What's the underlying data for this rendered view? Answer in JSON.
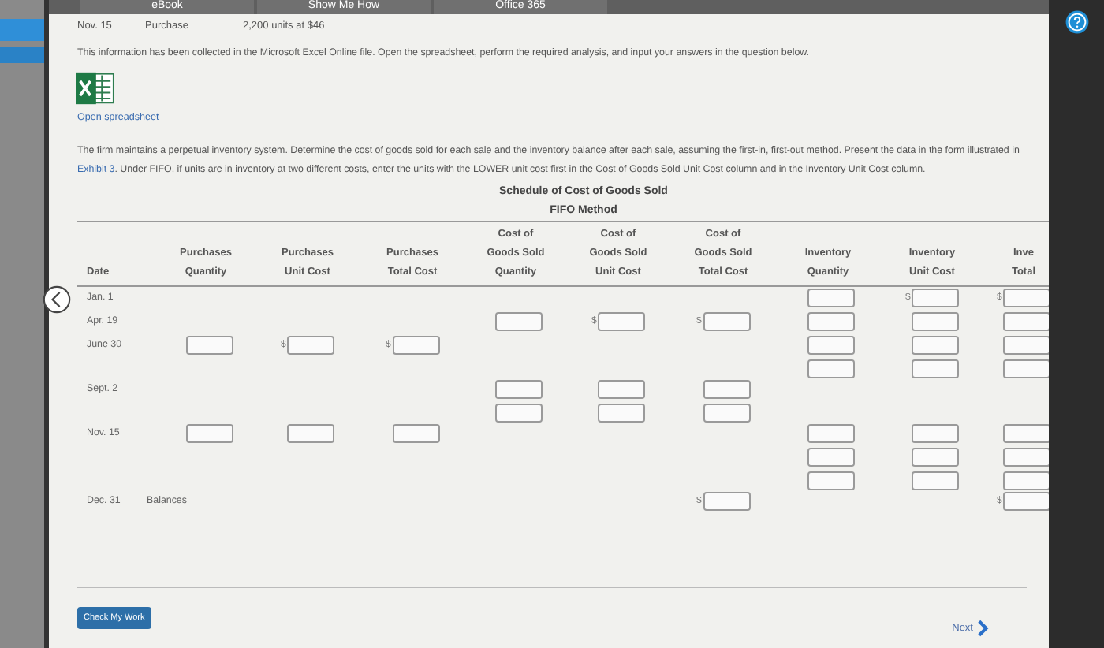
{
  "tabs": [
    {
      "label": "eBook"
    },
    {
      "label": "Show Me How"
    },
    {
      "label": "Office 365"
    }
  ],
  "info_row": {
    "date": "Nov. 15",
    "type": "Purchase",
    "detail": "2,200 units at $46"
  },
  "intro": "This information has been collected in the Microsoft Excel Online file. Open the spreadsheet, perform the required analysis, and input your answers in the question below.",
  "spreadsheet_link": "Open spreadsheet",
  "instructions": {
    "before": "The firm maintains a perpetual inventory system. Determine the cost of goods sold for each sale and the inventory balance after each sale, assuming the first-in, first-out method. Present the data in the form illustrated in ",
    "link": "Exhibit 3",
    "after": ". Under FIFO, if units are in inventory at two different costs, enter the units with the LOWER unit cost first in the Cost of Goods Sold Unit Cost column and in the Inventory Unit Cost column."
  },
  "schedule": {
    "title": "Schedule of Cost of Goods Sold",
    "subtitle": "FIFO Method",
    "columns": [
      "Date",
      "Purchases Quantity",
      "Purchases Unit Cost",
      "Purchases Total Cost",
      "Cost of Goods Sold Quantity",
      "Cost of Goods Sold Unit Cost",
      "Cost of Goods Sold Total Cost",
      "Inventory Quantity",
      "Inventory Unit Cost",
      "Inve Total"
    ],
    "rows": [
      {
        "cells": [
          {
            "text": "Jan. 1"
          },
          {},
          {},
          {},
          {},
          {},
          {},
          {
            "fields": [
              {
                "kind": "plain"
              }
            ]
          },
          {
            "fields": [
              {
                "kind": "money",
                "prefix": "$"
              }
            ]
          },
          {
            "fields": [
              {
                "kind": "money",
                "prefix": "$"
              }
            ]
          }
        ]
      },
      {
        "cells": [
          {
            "text": "Apr. 19"
          },
          {},
          {},
          {},
          {
            "fields": [
              {
                "kind": "plain"
              }
            ]
          },
          {
            "fields": [
              {
                "kind": "money",
                "prefix": "$"
              }
            ]
          },
          {
            "fields": [
              {
                "kind": "money",
                "prefix": "$"
              }
            ]
          },
          {
            "fields": [
              {
                "kind": "plain"
              }
            ]
          },
          {
            "fields": [
              {
                "kind": "plain"
              }
            ]
          },
          {
            "fields": [
              {
                "kind": "plain"
              }
            ]
          }
        ]
      },
      {
        "cells": [
          {
            "text": "June 30"
          },
          {
            "fields": [
              {
                "kind": "plain"
              }
            ]
          },
          {
            "fields": [
              {
                "kind": "money",
                "prefix": "$"
              }
            ]
          },
          {
            "fields": [
              {
                "kind": "money",
                "prefix": "$"
              }
            ]
          },
          {},
          {},
          {},
          {
            "fields": [
              {
                "kind": "plain"
              },
              {
                "kind": "plain"
              }
            ]
          },
          {
            "fields": [
              {
                "kind": "plain"
              },
              {
                "kind": "plain"
              }
            ]
          },
          {
            "fields": [
              {
                "kind": "plain"
              },
              {
                "kind": "plain"
              }
            ]
          }
        ]
      },
      {
        "cells": [
          {
            "text": "Sept. 2"
          },
          {},
          {},
          {},
          {
            "fields": [
              {
                "kind": "plain"
              },
              {
                "kind": "plain"
              }
            ]
          },
          {
            "fields": [
              {
                "kind": "plain"
              },
              {
                "kind": "plain"
              }
            ]
          },
          {
            "fields": [
              {
                "kind": "plain"
              },
              {
                "kind": "plain"
              }
            ]
          },
          {},
          {},
          {}
        ]
      },
      {
        "cells": [
          {
            "text": "Nov. 15"
          },
          {
            "fields": [
              {
                "kind": "plain"
              }
            ]
          },
          {
            "fields": [
              {
                "kind": "plain"
              }
            ]
          },
          {
            "fields": [
              {
                "kind": "plain"
              }
            ]
          },
          {},
          {},
          {},
          {
            "fields": [
              {
                "kind": "plain"
              },
              {
                "kind": "plain"
              },
              {
                "kind": "plain"
              }
            ]
          },
          {
            "fields": [
              {
                "kind": "plain"
              },
              {
                "kind": "plain"
              },
              {
                "kind": "plain"
              }
            ]
          },
          {
            "fields": [
              {
                "kind": "plain"
              },
              {
                "kind": "plain"
              },
              {
                "kind": "plain"
              }
            ]
          }
        ]
      },
      {
        "cells": [
          {
            "text": "Dec. 31"
          },
          {
            "text": "Balances"
          },
          {},
          {},
          {},
          {},
          {
            "fields": [
              {
                "kind": "money",
                "prefix": "$"
              }
            ]
          },
          {},
          {},
          {
            "fields": [
              {
                "kind": "money",
                "prefix": "$"
              }
            ]
          }
        ]
      }
    ]
  },
  "check_button": "Check My Work",
  "next_link": "Next"
}
